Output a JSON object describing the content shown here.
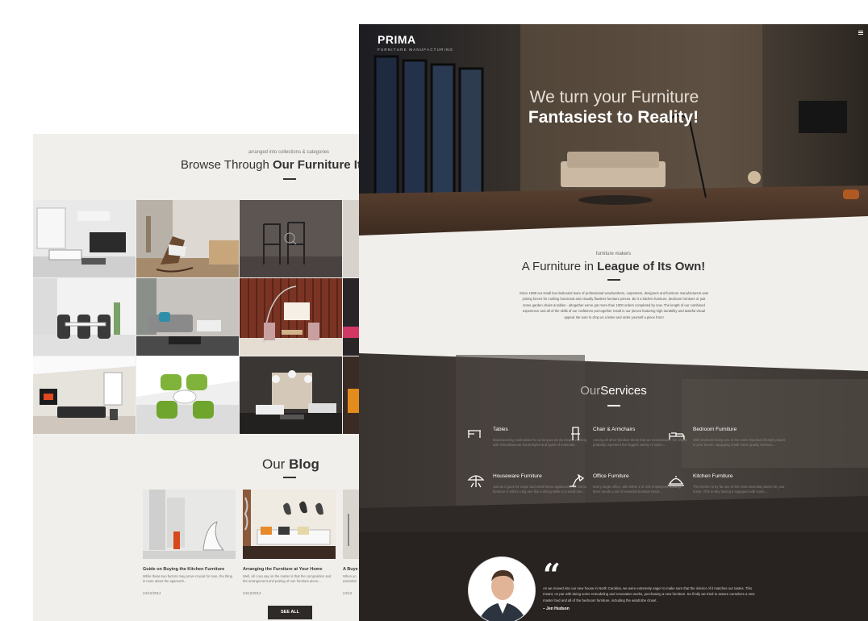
{
  "left_page": {
    "browse": {
      "kicker": "arranged into collections & categories",
      "title_light": "Browse Through",
      "title_bold": "Our Furniture Items"
    },
    "blog": {
      "title_light": "Our",
      "title_bold": "Blog",
      "posts": [
        {
          "title": "Guide on Buying the Kitchen Furniture",
          "excerpt": "While these two factors may prove crucial for sure, the thing is more about the approach...",
          "date": "24/12/2014"
        },
        {
          "title": "Arranging the Furniture at Your Home",
          "excerpt": "Well, all I can say on the matter is that the composition and the arrangement and pairing of one furniture piece...",
          "date": "24/12/2014"
        },
        {
          "title": "A Buye",
          "excerpt": "When yo essential",
          "date": "24/12"
        }
      ],
      "see_all": "SEE ALL"
    }
  },
  "right_page": {
    "header": {
      "logo": "PRIMA",
      "logo_sub": "FURNITURE MANUFACTURING",
      "menu_icon": "hamburger-icon"
    },
    "hero": {
      "line1": "We turn your Furniture",
      "line2": "Fantasiest to Reality!"
    },
    "about": {
      "kicker": "furniture makers",
      "title_light": "A Furniture in",
      "title_bold": "League of Its Own!",
      "body": "Since 1988 our small but dedicated team of professional woodworkers, carpenters, designers and furniture manufacturers was joining forces for crafting functional and visually flawless furniture pieces. Be it a kitchen furniture, bedroom furniture or just some garden chairs & tables - altogether we've got more than 1000 orders completed by now. The length of our combined experience and all of the skills of our craftsmen put together result in our pieces featuring high durability and tasteful visual appeal. Be sure to drop us a letter and order yourself a piece from!"
    },
    "services": {
      "title_light": "Our",
      "title_bold": "Services",
      "items": [
        {
          "name": "Tables",
          "icon": "table-icon",
          "desc": "Manufacturing craft tables for as long as we do means working with miscellaneous visual styles and types of materials..."
        },
        {
          "name": "Chair & Armchairs",
          "icon": "chair-icon",
          "desc": "Among all other furniture items that we manufacture, the chairs probably represent the biggest variety of styles..."
        },
        {
          "name": "Bedroom Furniture",
          "icon": "bed-icon",
          "desc": "With bedroom being one of the most important lifestyle places in your house, equipping it with some quality furniture..."
        },
        {
          "name": "Houseware Furniture",
          "icon": "garden-umbrella-icon",
          "desc": "Just as it goes for major and small home appliances, the home furniture is either a big one like a dining table or a small one..."
        },
        {
          "name": "Office Furniture",
          "icon": "office-lamp-icon",
          "desc": "Every single office, with either 2 or 200 employees working there needs a set of essential furniture items..."
        },
        {
          "name": "Kitchen Furniture",
          "icon": "cloche-icon",
          "desc": "The kitchen is by far one of the most essential places for your home. This is why having it equipped with some..."
        }
      ]
    },
    "testimonial": {
      "quote": "As we moved into our new house in North Carolina, we were extremely eager to make sure that the interior of it matches our tastes. This meant, on par with doing some remodeling and renovation works, purchasing a new furniture. So firstly we tried to assure ourselves a new master bed and all of the bedroom furniture, including the wardrobe closet.",
      "author": "– Jen Hudson"
    }
  }
}
